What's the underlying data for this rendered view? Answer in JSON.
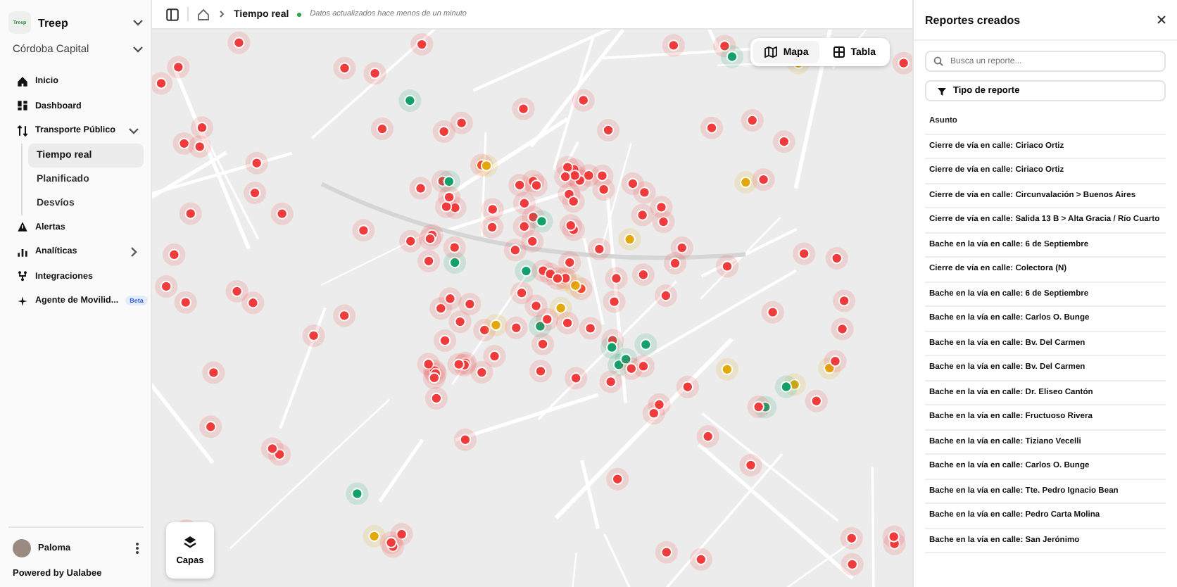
{
  "sidebar": {
    "logo": "Treep",
    "org": "Treep",
    "workspace": "Córdoba Capital",
    "items": [
      {
        "label": "Inicio",
        "selected": false
      },
      {
        "label": "Dashboard",
        "selected": false
      },
      {
        "label": "Transporte Público",
        "selected": false,
        "expanded": true,
        "children": [
          {
            "label": "Tiempo real",
            "selected": true
          },
          {
            "label": "Planificado",
            "selected": false
          },
          {
            "label": "Desvíos",
            "selected": false
          }
        ]
      },
      {
        "label": "Alertas",
        "selected": false
      },
      {
        "label": "Analíticas",
        "selected": false,
        "expanded": false
      },
      {
        "label": "Integraciones",
        "selected": false
      },
      {
        "label": "Agente de Movilid...",
        "selected": false,
        "badge": "Beta"
      }
    ],
    "user": {
      "name": "Paloma"
    },
    "footer": "Powered by Ualabee"
  },
  "breadcrumb": {
    "current": "Tiempo real",
    "status": "Datos actualizados hace menos de un minuto"
  },
  "view_toggle": [
    {
      "label": "Mapa",
      "selected": true
    },
    {
      "label": "Tabla",
      "selected": false
    }
  ],
  "layers_button": "Capas",
  "reports_panel": {
    "title": "Reportes creados",
    "search": {
      "placeholder": "Busca un reporte..."
    },
    "filter": "Tipo de reporte",
    "column": "Asunto",
    "rows": [
      "Cierre de vía en calle: Ciriaco Ortiz",
      "Cierre de vía en calle: Ciriaco Ortiz",
      "Cierre de vía en calle: Circunvalación > Buenos Aires",
      "Cierre de vía en calle: Salida 13 B > Alta Gracia / Río Cuarto",
      "Bache en la vía en calle: 6 de Septiembre",
      "Cierre de vía en calle: Colectora (N)",
      "Bache en la vía en calle: 6 de Septiembre",
      "Bache en la vía en calle: Carlos O. Bunge",
      "Bache en la vía en calle: Bv. Del Carmen",
      "Bache en la vía en calle: Bv. Del Carmen",
      "Bache en la vía en calle: Dr. Eliseo Cantón",
      "Bache en la vía en calle: Fructuoso Rivera",
      "Bache en la vía en calle: Tiziano Vecelli",
      "Bache en la vía en calle: Carlos O. Bunge",
      "Bache en la vía en calle: Tte. Pedro Ignacio Bean",
      "Bache en la vía en calle: Pedro Carta Molina",
      "Bache en la vía en calle: San Jerónimo"
    ]
  }
}
